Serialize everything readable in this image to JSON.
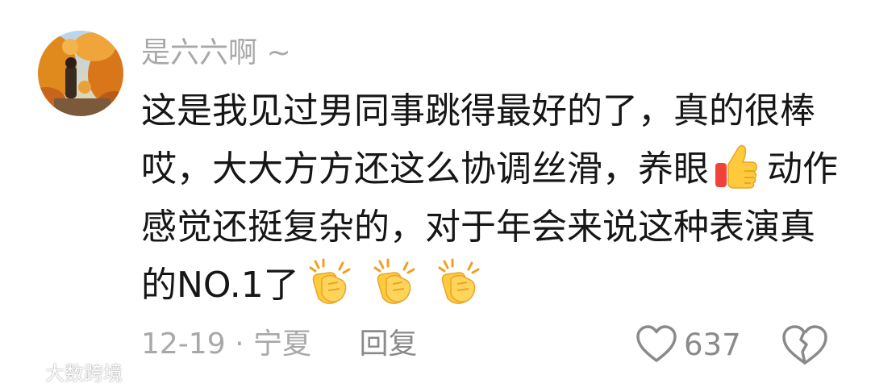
{
  "comment": {
    "username": "是六六啊 ~",
    "lines": [
      "这是我见过男同事跳得最好的了，真的很棒",
      "哎，大大方方还这么协调丝滑，养眼",
      "动作",
      "感觉还挺复杂的，对于年会来说这种表演真",
      "的NO.1了"
    ],
    "emojis": {
      "thumb": "thumbs-up-emoji",
      "clap": "clapping-hands-emoji"
    },
    "date": "12-19",
    "separator": "·",
    "location": "宁夏",
    "reply_label": "回复",
    "like_count": "637"
  },
  "watermark": {
    "text": "大数跨境"
  },
  "colors": {
    "meta_gray": "#a8a8a8",
    "text": "#161616",
    "icon_gray": "#8a8a8a",
    "emoji_yellow": "#ffcb3d",
    "thumb_red": "#f0423b"
  }
}
